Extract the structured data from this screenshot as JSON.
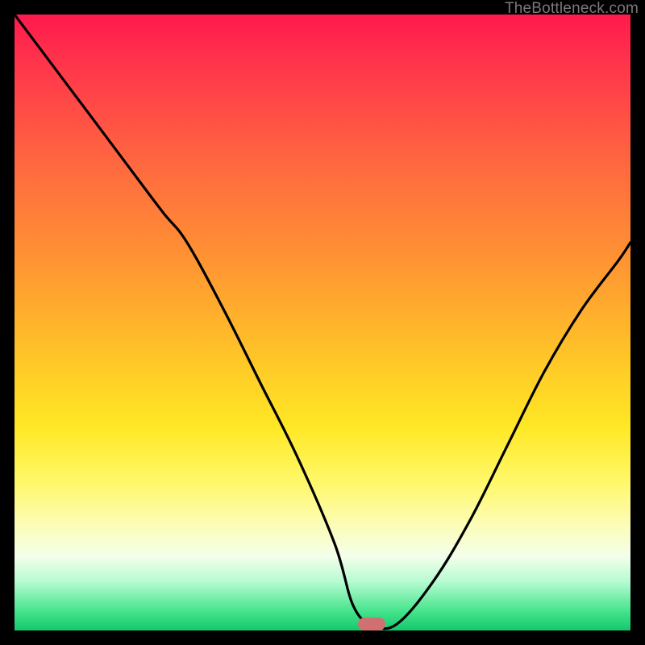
{
  "attribution": "TheBottleneck.com",
  "colors": {
    "background": "#000000",
    "marker": "#d17072",
    "curve": "#000000",
    "gradient_top": "#ff1a4d",
    "gradient_mid": "#ffe825",
    "gradient_bottom": "#14c86d"
  },
  "chart_data": {
    "type": "line",
    "title": "",
    "xlabel": "",
    "ylabel": "",
    "x_range": [
      0,
      100
    ],
    "y_range": [
      0,
      100
    ],
    "grid": false,
    "legend": false,
    "notes": "V-shaped bottleneck curve over a vertical red→yellow→green gradient. Lower y = better (green). Minimum reached near x≈58 where marker sits. No axis ticks or numeric labels shown in source image; values below are estimated from geometry (y in percent of height from bottom).",
    "series": [
      {
        "name": "bottleneck-curve",
        "x": [
          0,
          6,
          12,
          18,
          24,
          28,
          34,
          40,
          46,
          52,
          55,
          58,
          62,
          68,
          74,
          80,
          86,
          92,
          98,
          100
        ],
        "y": [
          100,
          92,
          84,
          76,
          68,
          63,
          52,
          40,
          28,
          14,
          4,
          1,
          1,
          8,
          18,
          30,
          42,
          52,
          60,
          63
        ]
      }
    ],
    "marker": {
      "x": 58,
      "y": 1,
      "shape": "rounded-rect",
      "color": "#d17072"
    }
  }
}
